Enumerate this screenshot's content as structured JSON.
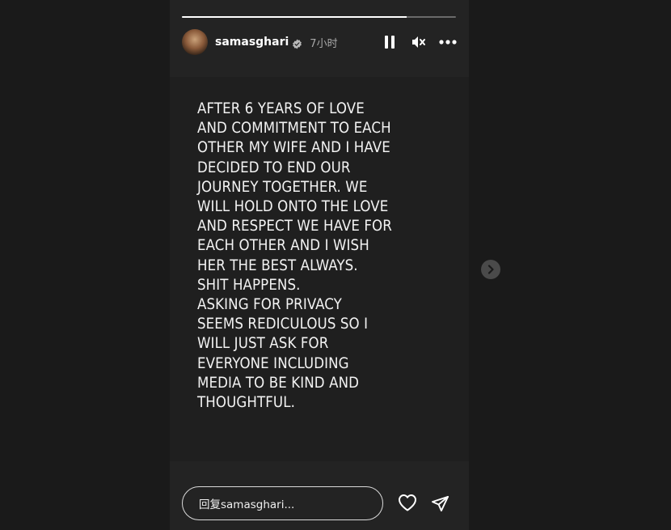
{
  "story": {
    "progress": 0.82,
    "user": {
      "username": "samasghari",
      "verified": true,
      "time_ago": "7小时"
    },
    "controls": {
      "pause_icon": "pause-icon",
      "mute_icon": "muted-speaker-icon",
      "more_icon": "more-options-icon"
    },
    "text": "AFTER 6 YEARS OF LOVE\nAND COMMITMENT TO EACH\nOTHER MY WIFE AND I HAVE\nDECIDED TO END OUR\nJOURNEY TOGETHER. WE\nWILL HOLD ONTO THE LOVE\nAND RESPECT WE HAVE FOR\nEACH OTHER AND I WISH\nHER THE BEST ALWAYS.\nSHIT HAPPENS.\nASKING FOR PRIVACY\nSEEMS REDICULOUS SO I\nWILL JUST ASK FOR\nEVERYONE INCLUDING\nMEDIA TO BE KIND AND\nTHOUGHTFUL.",
    "reply_placeholder": "回复samasghari..."
  },
  "colors": {
    "background": "#1a1a1a",
    "panel": "#232323",
    "text": "#ffffff",
    "muted": "#a8a8a8"
  }
}
